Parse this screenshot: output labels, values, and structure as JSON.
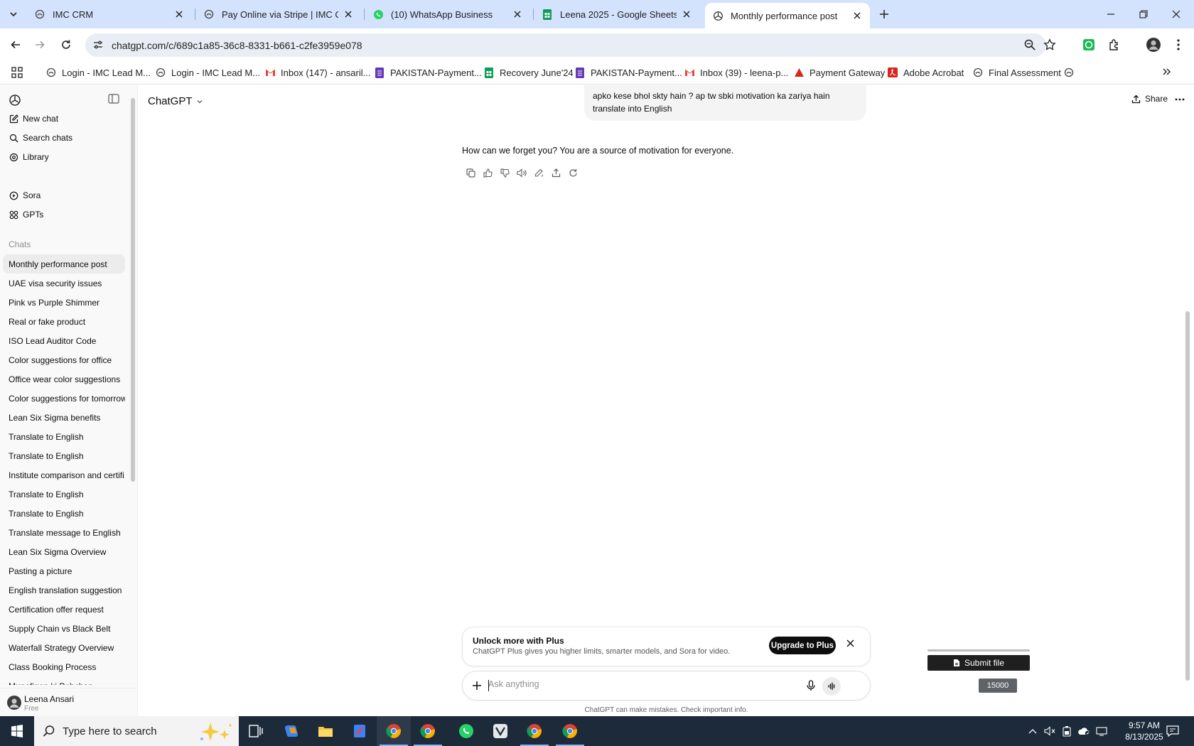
{
  "browser": {
    "tabs": [
      {
        "title": "IMC CRM",
        "favicon": "imc-logo-icon"
      },
      {
        "title": "Pay Online via Stripe | IMC Certi",
        "favicon": "imc-logo-icon"
      },
      {
        "title": "(10) WhatsApp Business",
        "favicon": "whatsapp-icon"
      },
      {
        "title": "Leena 2025 - Google Sheets",
        "favicon": "sheets-icon"
      },
      {
        "title": "Monthly performance post",
        "favicon": "openai-icon"
      }
    ],
    "url": "chatgpt.com/c/689c1a85-36c8-8331-b661-c2fe3959e078",
    "bookmarks": [
      {
        "label": "Login - IMC Lead M...",
        "icon": "imc-logo-icon"
      },
      {
        "label": "Login - IMC Lead M...",
        "icon": "imc-logo-icon"
      },
      {
        "label": "Inbox (147) - ansaril...",
        "icon": "gmail-icon"
      },
      {
        "label": "PAKISTAN-Payment...",
        "icon": "forms-icon"
      },
      {
        "label": "Recovery June'24",
        "icon": "sheets-icon"
      },
      {
        "label": "PAKISTAN-Payment...",
        "icon": "forms-icon"
      },
      {
        "label": "Inbox (39) - leena-p...",
        "icon": "gmail-icon"
      },
      {
        "label": "Payment Gateway",
        "icon": "acrobat-icon"
      },
      {
        "label": "Adobe Acrobat",
        "icon": "acrobat-file-icon"
      },
      {
        "label": "Final Assessment",
        "icon": "imc-logo-icon"
      }
    ]
  },
  "sidebar": {
    "nav": [
      {
        "label": "New chat",
        "icon": "edit-icon"
      },
      {
        "label": "Search chats",
        "icon": "search-icon"
      },
      {
        "label": "Library",
        "icon": "library-icon"
      },
      {
        "label": "Sora",
        "icon": "play-circle-icon"
      },
      {
        "label": "GPTs",
        "icon": "grid-icon"
      }
    ],
    "chats_heading": "Chats",
    "chats": [
      "Monthly performance post",
      "UAE visa security issues",
      "Pink vs Purple Shimmer",
      "Real or fake product",
      "ISO Lead Auditor Code",
      "Color suggestions for office",
      "Office wear color suggestions",
      "Color suggestions for tomorrow",
      "Lean Six Sigma benefits",
      "Translate to English",
      "Translate to English",
      "Institute comparison and certifi...",
      "Translate to English",
      "Translate to English",
      "Translate message to English",
      "Lean Six Sigma Overview",
      "Pasting a picture",
      "English translation suggestion",
      "Certification offer request",
      "Supply Chain vs Black Belt",
      "Waterfall Strategy Overview",
      "Class Booking Process",
      "Munafiqon ki Pehchan"
    ],
    "user": {
      "name": "Leena Ansari",
      "plan": "Free"
    }
  },
  "main": {
    "model": "ChatGPT",
    "share_label": "Share",
    "user_message_line1": "apko kese bhol skty hain ? ap tw sbki motivation ka zariya hain",
    "user_message_line2": "translate into English",
    "assistant_message": "How can we forget you? You are a source of motivation for everyone.",
    "promo": {
      "title": "Unlock more with Plus",
      "subtitle": "ChatGPT Plus gives you higher limits, smarter models, and Sora for video.",
      "button": "Upgrade to Plus"
    },
    "composer_placeholder": "Ask anything",
    "disclaimer": "ChatGPT can make mistakes. Check important info.",
    "submit_file_label": "Submit file",
    "count_badge": "15000"
  },
  "taskbar": {
    "search_placeholder": "Type here to search",
    "time": "9:57 AM",
    "date": "8/13/2025"
  },
  "colors": {
    "tabstrip": "#d3e3fd",
    "omnibox": "#e9eef6",
    "taskbar": "#1c2a3a",
    "sidebar": "#f9f9f9"
  }
}
